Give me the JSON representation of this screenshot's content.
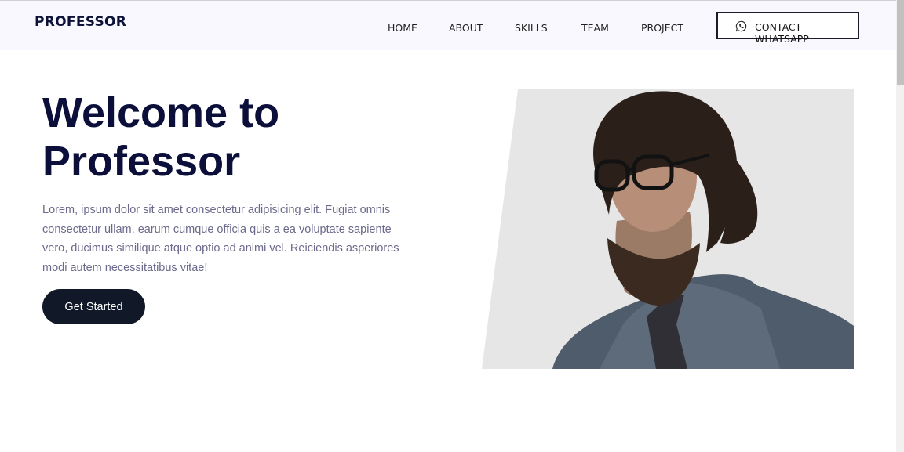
{
  "brand": "PROFESSOR",
  "nav": {
    "links": [
      "HOME",
      "ABOUT",
      "SKILLS",
      "TEAM",
      "PROJECT"
    ],
    "contact_button": "CONTACT WHATSAPP",
    "contact_icon": "whatsapp-icon"
  },
  "hero": {
    "title_line1": "Welcome to",
    "title_line2": "Professor",
    "description": "Lorem, ipsum dolor sit amet consectetur adipisicing elit. Fugiat omnis consectetur ullam, earum cumque officia quis a ea voluptate sapiente vero, ducimus similique atque optio ad animi vel. Reiciendis asperiores modi autem necessitatibus vitae!",
    "cta_label": "Get Started",
    "image": "portrait of a man with glasses and beard"
  },
  "colors": {
    "brand": "#0c1238",
    "heading": "#0b0f3a",
    "body_text": "#6b6a8c",
    "button_bg": "#111827",
    "nav_bg": "#f8f8fe",
    "image_bg": "#e6e6e6"
  }
}
